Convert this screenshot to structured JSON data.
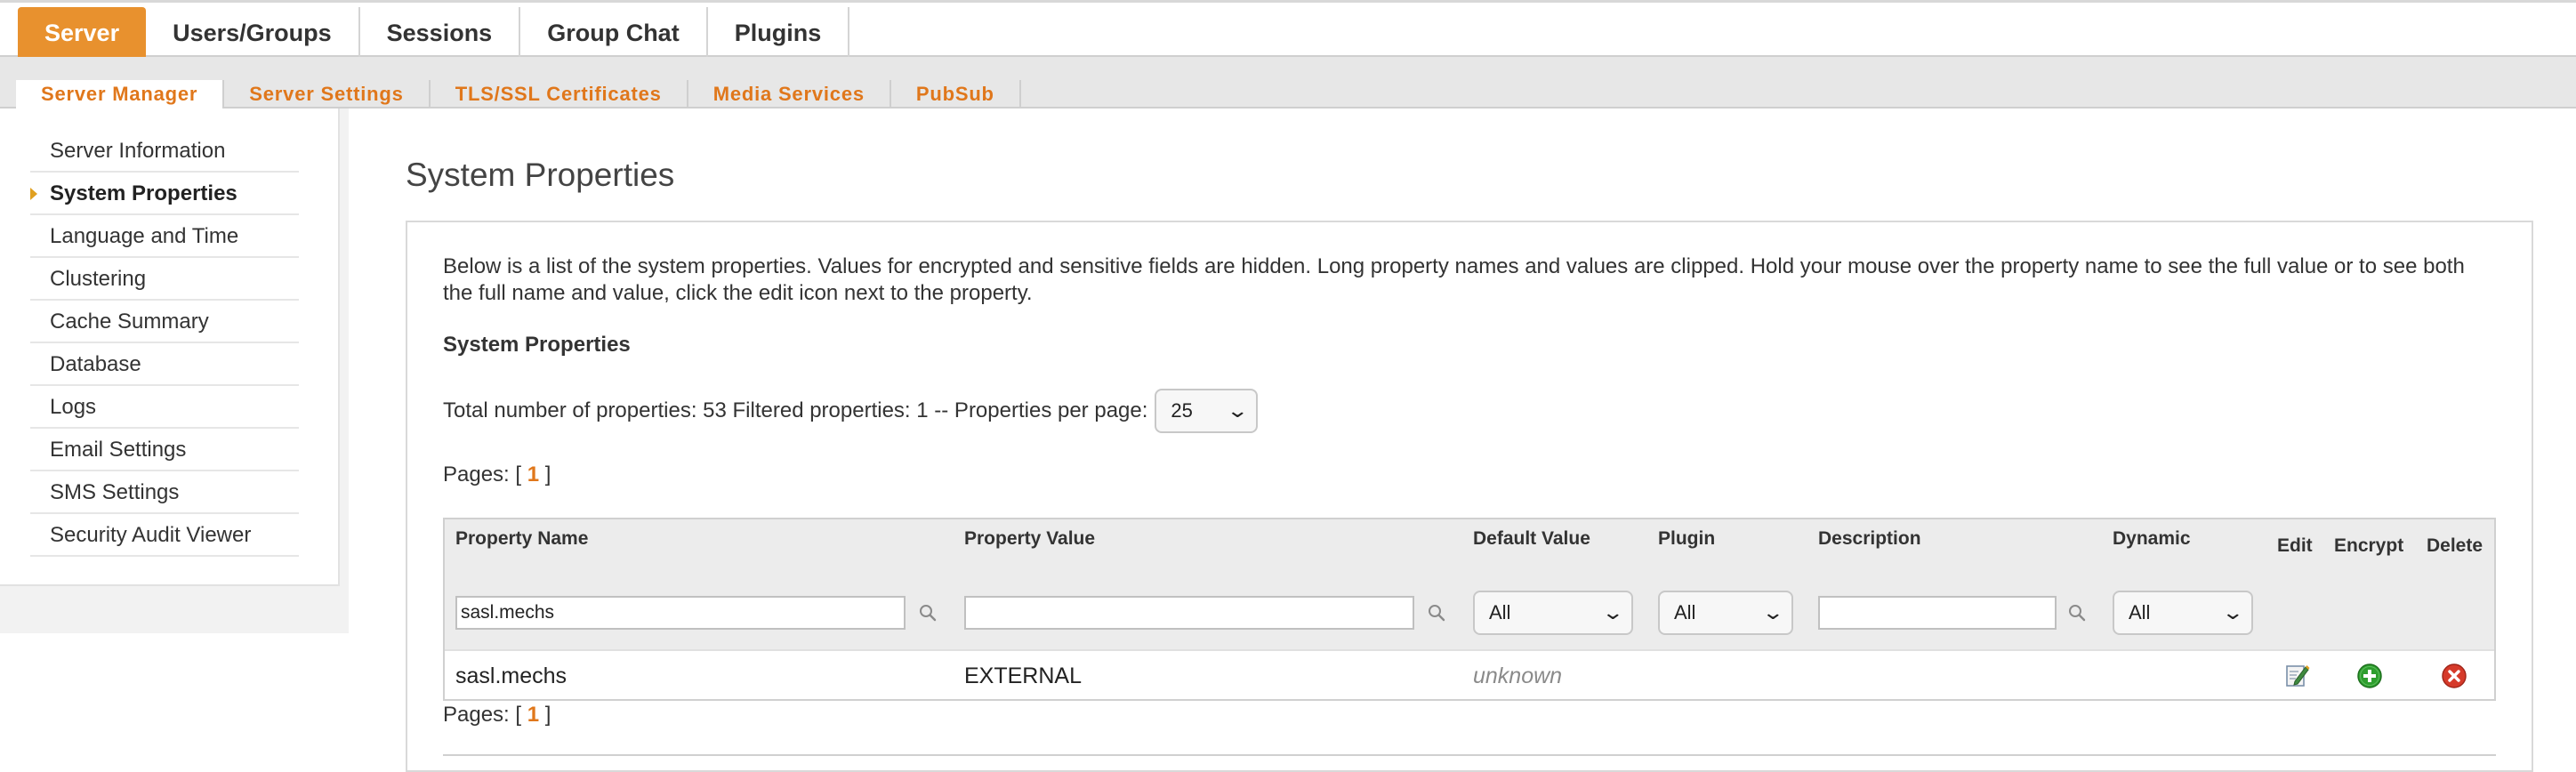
{
  "top_nav": {
    "tabs": [
      {
        "label": "Server",
        "active": true
      },
      {
        "label": "Users/Groups",
        "active": false
      },
      {
        "label": "Sessions",
        "active": false
      },
      {
        "label": "Group Chat",
        "active": false
      },
      {
        "label": "Plugins",
        "active": false
      }
    ]
  },
  "sub_nav": {
    "tabs": [
      {
        "label": "Server Manager",
        "active": true
      },
      {
        "label": "Server Settings",
        "active": false
      },
      {
        "label": "TLS/SSL Certificates",
        "active": false
      },
      {
        "label": "Media Services",
        "active": false
      },
      {
        "label": "PubSub",
        "active": false
      }
    ]
  },
  "sidebar": {
    "items": [
      {
        "label": "Server Information",
        "active": false
      },
      {
        "label": "System Properties",
        "active": true
      },
      {
        "label": "Language and Time",
        "active": false
      },
      {
        "label": "Clustering",
        "active": false
      },
      {
        "label": "Cache Summary",
        "active": false
      },
      {
        "label": "Database",
        "active": false
      },
      {
        "label": "Logs",
        "active": false
      },
      {
        "label": "Email Settings",
        "active": false
      },
      {
        "label": "SMS Settings",
        "active": false
      },
      {
        "label": "Security Audit Viewer",
        "active": false
      }
    ]
  },
  "main": {
    "page_title": "System Properties",
    "description": "Below is a list of the system properties. Values for encrypted and sensitive fields are hidden. Long property names and values are clipped. Hold your mouse over the property name to see the full value or to see both the full name and value, click the edit icon next to the property.",
    "section_title": "System Properties",
    "totals_text": "Total number of properties: 53 Filtered properties: 1 -- Properties per page:",
    "per_page": "25",
    "pages_prefix": "Pages: [",
    "pages_current": "1",
    "pages_suffix": "]"
  },
  "table": {
    "headers": {
      "name": "Property Name",
      "value": "Property Value",
      "default": "Default Value",
      "plugin": "Plugin",
      "description": "Description",
      "dynamic": "Dynamic",
      "edit": "Edit",
      "encrypt": "Encrypt",
      "delete": "Delete"
    },
    "filters": {
      "name": "sasl.mechs",
      "value": "",
      "default": "All",
      "plugin": "All",
      "description": "",
      "dynamic": "All"
    },
    "rows": [
      {
        "name": "sasl.mechs",
        "value": "EXTERNAL",
        "default": "unknown",
        "plugin": "",
        "description": "",
        "dynamic": ""
      }
    ]
  },
  "icons": {
    "search": "magnifier-icon",
    "edit": "edit-pencil-icon",
    "encrypt": "green-plus-icon",
    "delete": "red-x-icon"
  },
  "colors": {
    "accent": "#e8912e",
    "link": "#e0771b",
    "encrypt": "#2e9e2e",
    "delete": "#d63a2a"
  }
}
